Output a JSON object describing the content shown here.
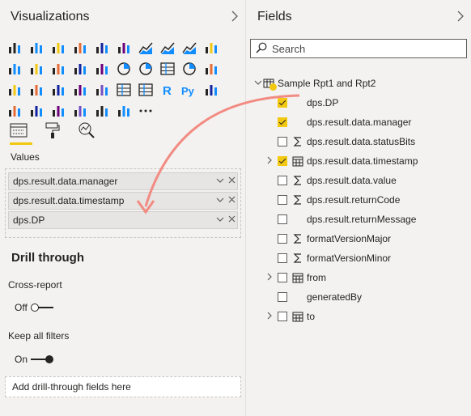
{
  "visualizations": {
    "title": "Visualizations",
    "collapse_icon": "chevron-right-icon",
    "visual_icons_rows": [
      [
        "stacked-bar-icon",
        "stacked-column-icon",
        "clustered-bar-icon",
        "clustered-column-icon",
        "100-bar-icon",
        "100-column-icon",
        "line-chart-icon",
        "area-chart-icon",
        "stacked-area-icon",
        "line-column-icon"
      ],
      [
        "line-clustered-column-icon",
        "ribbon-chart-icon",
        "waterfall-icon",
        "funnel-icon",
        "scatter-icon",
        "pie-chart-icon",
        "donut-chart-icon",
        "treemap-icon",
        "map-icon",
        "filled-map-icon"
      ],
      [
        "gauge-icon",
        "card-icon",
        "multirow-card-icon",
        "kpi-icon",
        "slicer-icon",
        "table-icon",
        "matrix-icon",
        "r-visual-icon",
        "python-visual-icon",
        "key-influencers-icon"
      ],
      [
        "decomposition-tree-icon",
        "qa-icon",
        "paginated-report-icon",
        "arcgis-map-icon",
        "power-apps-icon",
        "power-automate-icon",
        "more-visuals-icon"
      ]
    ],
    "subtabs": {
      "fields_tab_icon": "fields-well-icon",
      "format_tab_icon": "paint-roller-icon",
      "analytics_tab_icon": "analytics-magnifier-icon"
    },
    "values_label": "Values",
    "wells": [
      {
        "label": "dps.result.data.manager"
      },
      {
        "label": "dps.result.data.timestamp"
      },
      {
        "label": "dps.DP"
      }
    ],
    "drill_through": {
      "title": "Drill through",
      "cross_report_label": "Cross-report",
      "cross_report_state": "Off",
      "keep_filters_label": "Keep all filters",
      "keep_filters_state": "On",
      "add_placeholder": "Add drill-through fields here"
    }
  },
  "fields": {
    "title": "Fields",
    "collapse_icon": "chevron-right-icon",
    "search_placeholder": "Search",
    "table": {
      "name": "Sample Rpt1 and Rpt2",
      "items": [
        {
          "label": "dps.DP",
          "checked": true,
          "icon": "none",
          "expandable": false
        },
        {
          "label": "dps.result.data.manager",
          "checked": true,
          "icon": "none",
          "expandable": false
        },
        {
          "label": "dps.result.data.statusBits",
          "checked": false,
          "icon": "sigma-icon",
          "expandable": false
        },
        {
          "label": "dps.result.data.timestamp",
          "checked": true,
          "icon": "calendar-icon",
          "expandable": true
        },
        {
          "label": "dps.result.data.value",
          "checked": false,
          "icon": "sigma-icon",
          "expandable": false
        },
        {
          "label": "dps.result.returnCode",
          "checked": false,
          "icon": "sigma-icon",
          "expandable": false
        },
        {
          "label": "dps.result.returnMessage",
          "checked": false,
          "icon": "none",
          "expandable": false
        },
        {
          "label": "formatVersionMajor",
          "checked": false,
          "icon": "sigma-icon",
          "expandable": false
        },
        {
          "label": "formatVersionMinor",
          "checked": false,
          "icon": "sigma-icon",
          "expandable": false
        },
        {
          "label": "from",
          "checked": false,
          "icon": "calendar-icon",
          "expandable": true
        },
        {
          "label": "generatedBy",
          "checked": false,
          "icon": "none",
          "expandable": false
        },
        {
          "label": "to",
          "checked": false,
          "icon": "calendar-icon",
          "expandable": true
        }
      ]
    }
  },
  "colors": {
    "accent": "#f2c811",
    "annotation_arrow": "#f28b82",
    "pane_bg": "#f3f2f1"
  }
}
